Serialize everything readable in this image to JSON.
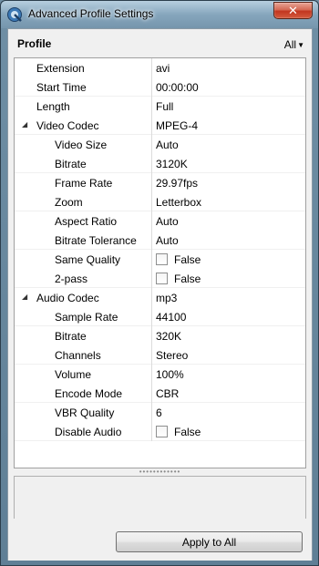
{
  "window": {
    "title": "Advanced Profile Settings",
    "close_label": "✕"
  },
  "header": {
    "title": "Profile",
    "filter_value": "All"
  },
  "properties": [
    {
      "name": "Extension",
      "value": "avi",
      "level": 0,
      "type": "text"
    },
    {
      "name": "Start Time",
      "value": "00:00:00",
      "level": 0,
      "type": "text"
    },
    {
      "name": "Length",
      "value": "Full",
      "level": 0,
      "type": "text"
    },
    {
      "name": "Video Codec",
      "value": "MPEG-4",
      "level": 0,
      "type": "group",
      "expanded": true
    },
    {
      "name": "Video Size",
      "value": "Auto",
      "level": 1,
      "type": "text"
    },
    {
      "name": "Bitrate",
      "value": "3120K",
      "level": 1,
      "type": "text"
    },
    {
      "name": "Frame Rate",
      "value": "29.97fps",
      "level": 1,
      "type": "text"
    },
    {
      "name": "Zoom",
      "value": "Letterbox",
      "level": 1,
      "type": "text"
    },
    {
      "name": "Aspect Ratio",
      "value": "Auto",
      "level": 1,
      "type": "text"
    },
    {
      "name": "Bitrate Tolerance",
      "value": "Auto",
      "level": 1,
      "type": "text"
    },
    {
      "name": "Same Quality",
      "value": "False",
      "level": 1,
      "type": "checkbox",
      "checked": false
    },
    {
      "name": "2-pass",
      "value": "False",
      "level": 1,
      "type": "checkbox",
      "checked": false
    },
    {
      "name": "Audio Codec",
      "value": "mp3",
      "level": 0,
      "type": "group",
      "expanded": true
    },
    {
      "name": "Sample Rate",
      "value": "44100",
      "level": 1,
      "type": "text"
    },
    {
      "name": "Bitrate",
      "value": "320K",
      "level": 1,
      "type": "text"
    },
    {
      "name": "Channels",
      "value": "Stereo",
      "level": 1,
      "type": "text"
    },
    {
      "name": "Volume",
      "value": "100%",
      "level": 1,
      "type": "text"
    },
    {
      "name": "Encode Mode",
      "value": "CBR",
      "level": 1,
      "type": "text"
    },
    {
      "name": "VBR Quality",
      "value": "6",
      "level": 1,
      "type": "text"
    },
    {
      "name": "Disable Audio",
      "value": "False",
      "level": 1,
      "type": "checkbox",
      "checked": false
    }
  ],
  "footer": {
    "apply_label": "Apply to All"
  },
  "icons": {
    "app": "app-logo-icon",
    "expander": "triangle-expanded-icon",
    "splitter": "splitter-grip-icon"
  },
  "colors": {
    "titlebar": "#86a6bd",
    "close": "#c2351f",
    "panel": "#f0f0f0"
  }
}
